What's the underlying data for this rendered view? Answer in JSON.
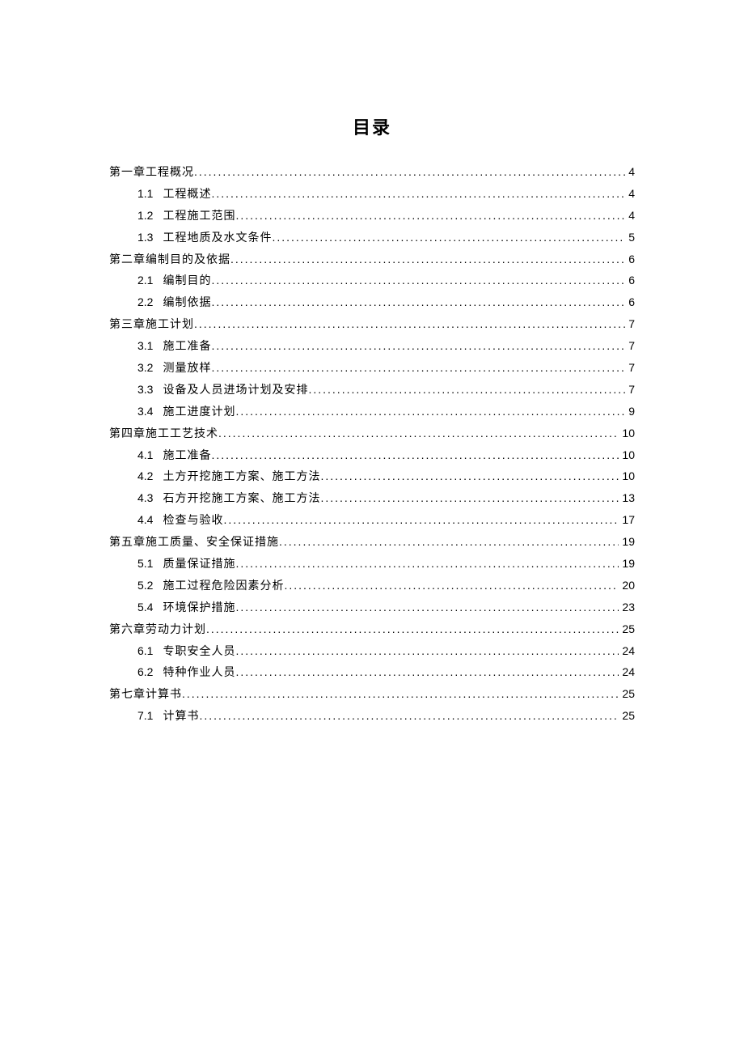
{
  "title": "目录",
  "toc": [
    {
      "level": "chapter",
      "number": "",
      "text": "第一章工程概况",
      "page": "4"
    },
    {
      "level": "section",
      "number": "1.1",
      "text": "工程概述",
      "page": "4"
    },
    {
      "level": "section",
      "number": "1.2",
      "text": "工程施工范围",
      "page": "4"
    },
    {
      "level": "section",
      "number": "1.3",
      "text": "工程地质及水文条件",
      "page": "5"
    },
    {
      "level": "chapter",
      "number": "",
      "text": "第二章编制目的及依据",
      "page": "6"
    },
    {
      "level": "section",
      "number": "2.1",
      "text": "编制目的",
      "page": "6"
    },
    {
      "level": "section",
      "number": "2.2",
      "text": "编制依据",
      "page": "6"
    },
    {
      "level": "chapter",
      "number": "",
      "text": "第三章施工计划",
      "page": "7"
    },
    {
      "level": "section",
      "number": "3.1",
      "text": "施工准备",
      "page": "7"
    },
    {
      "level": "section",
      "number": "3.2",
      "text": "测量放样",
      "page": "7"
    },
    {
      "level": "section",
      "number": "3.3",
      "text": "设备及人员进场计划及安排",
      "page": "7"
    },
    {
      "level": "section",
      "number": "3.4",
      "text": "施工进度计划",
      "page": "9"
    },
    {
      "level": "chapter",
      "number": "",
      "text": "第四章施工工艺技术",
      "page": "10"
    },
    {
      "level": "section",
      "number": "4.1",
      "text": "施工准备",
      "page": "10"
    },
    {
      "level": "section",
      "number": "4.2",
      "text": "土方开挖施工方案、施工方法",
      "page": "10"
    },
    {
      "level": "section",
      "number": "4.3",
      "text": "石方开挖施工方案、施工方法",
      "page": "13"
    },
    {
      "level": "section",
      "number": "4.4",
      "text": "检查与验收",
      "page": "17"
    },
    {
      "level": "chapter",
      "number": "",
      "text": "第五章施工质量、安全保证措施",
      "page": "19"
    },
    {
      "level": "section",
      "number": "5.1",
      "text": "质量保证措施",
      "page": "19"
    },
    {
      "level": "section",
      "number": "5.2",
      "text": "施工过程危险因素分析",
      "page": "20"
    },
    {
      "level": "section",
      "number": "5.4",
      "text": "环境保护措施",
      "page": "23"
    },
    {
      "level": "chapter",
      "number": "",
      "text": "第六章劳动力计划",
      "page": "25"
    },
    {
      "level": "section",
      "number": "6.1",
      "text": "专职安全人员",
      "page": "24"
    },
    {
      "level": "section",
      "number": "6.2",
      "text": "特种作业人员",
      "page": "24"
    },
    {
      "level": "chapter",
      "number": "",
      "text": "第七章计算书",
      "page": "25"
    },
    {
      "level": "section",
      "number": "7.1",
      "text": "计算书",
      "page": "25"
    }
  ]
}
